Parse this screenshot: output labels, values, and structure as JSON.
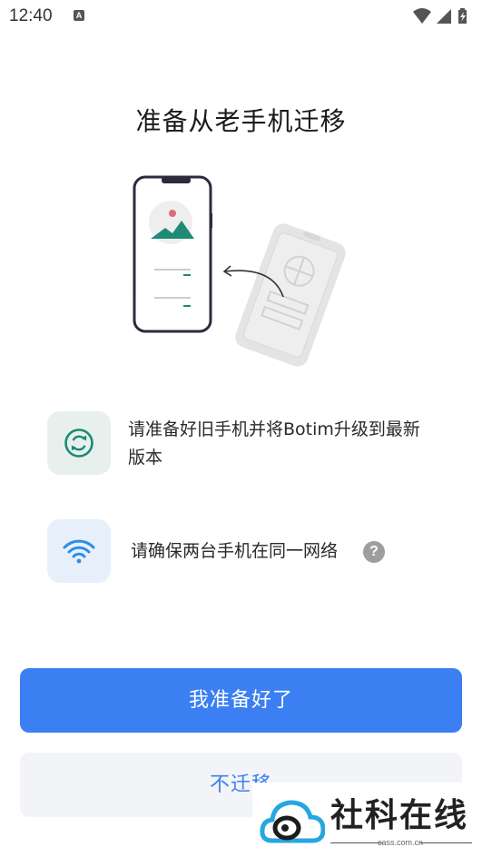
{
  "status_bar": {
    "time": "12:40",
    "notification_icon": "A",
    "icons": [
      "wifi-icon",
      "signal-icon",
      "battery-charging-icon"
    ]
  },
  "page": {
    "title": "准备从老手机迁移"
  },
  "steps": [
    {
      "icon": "sync-icon",
      "text": "请准备好旧手机并将Botim升级到最新版本"
    },
    {
      "icon": "wifi-icon",
      "text": "请确保两台手机在同一网络",
      "help": "?"
    }
  ],
  "buttons": {
    "primary_label": "我准备好了",
    "secondary_label": "不迁移"
  },
  "watermark": {
    "title": "社科在线",
    "subtitle": "cass.com.cn"
  },
  "colors": {
    "primary": "#3b7ff2",
    "sync_green": "#1b8a73",
    "wifi_blue": "#2f8de4"
  }
}
